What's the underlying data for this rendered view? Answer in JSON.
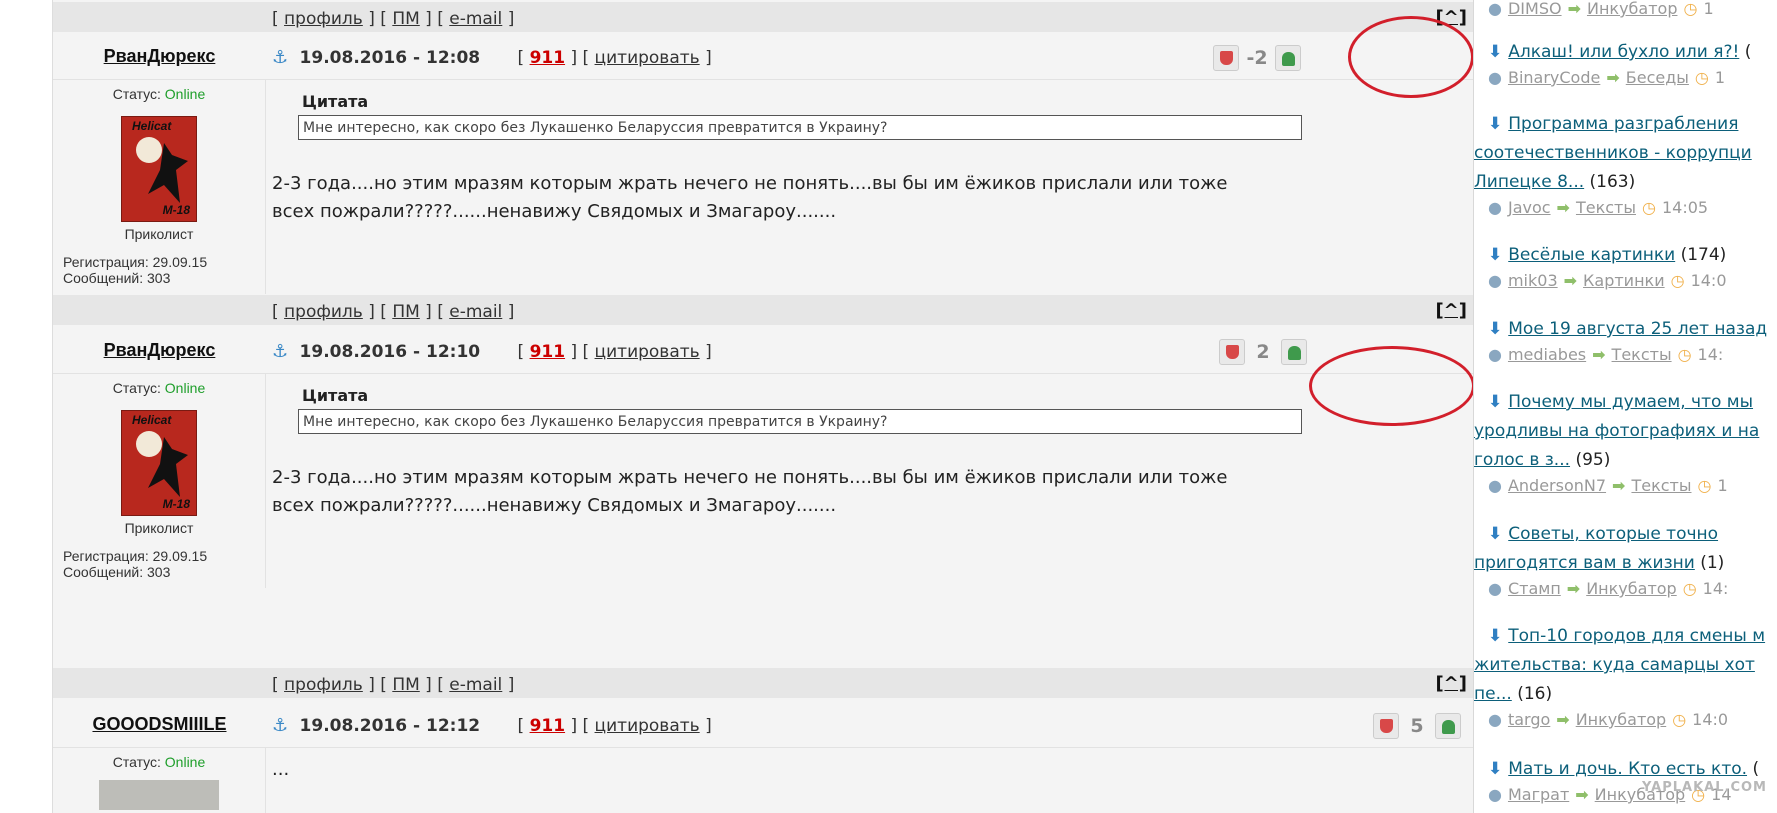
{
  "bar_links": {
    "open": "[",
    "profile": "профиль",
    "sep1": "] [",
    "pm": "ПМ",
    "sep2": "] [",
    "email": "e-mail",
    "close": "]",
    "top": "[^]"
  },
  "posts": [
    {
      "author": "РванДюрекс",
      "anchor": "⚓",
      "date": "19.08.2016 - 12:08",
      "num": "911",
      "cite": "цитировать",
      "rating": "-2",
      "status_label": "Статус:",
      "status": "Online",
      "avatar_text_top": "Helicat",
      "avatar_text_bottom": "M-18",
      "rank": "Приколист",
      "reg": "Регистрация: 29.09.15",
      "msgs": "Сообщений: 303",
      "quote_title": "Цитата",
      "quote": "Мне интересно, как скоро без Лукашенко Беларуссия превратится в Украину?",
      "text": "2-3 года....но этим мразям которым жрать нечего не понять....вы бы им ёжиков прислали или тоже всех пожрали?????......ненавижу Свядомых и Змагароу......."
    },
    {
      "author": "РванДюрекс",
      "anchor": "⚓",
      "date": "19.08.2016 - 12:10",
      "num": "911",
      "cite": "цитировать",
      "rating": "2",
      "status_label": "Статус:",
      "status": "Online",
      "avatar_text_top": "Helicat",
      "avatar_text_bottom": "M-18",
      "rank": "Приколист",
      "reg": "Регистрация: 29.09.15",
      "msgs": "Сообщений: 303",
      "quote_title": "Цитата",
      "quote": "Мне интересно, как скоро без Лукашенко Беларуссия превратится в Украину?",
      "text": "2-3 года....но этим мразям которым жрать нечего не понять....вы бы им ёжиков прислали или тоже всех пожрали?????......ненавижу Свядомых и Змагароу......."
    },
    {
      "author": "GOOODSMIIILE",
      "anchor": "⚓",
      "date": "19.08.2016 - 12:12",
      "num": "911",
      "cite": "цитировать",
      "rating": "5",
      "status_label": "Статус:",
      "status": "Online",
      "text": "..."
    }
  ],
  "sidebar": {
    "items": [
      {
        "title": "",
        "count": "",
        "user": "DIMSO",
        "section": "Инкубатор",
        "time": "1"
      },
      {
        "title": "Алкаш! или бухло или я?!",
        "count": "(",
        "user": "BinaryCode",
        "section": "Беседы",
        "time": "1"
      },
      {
        "title_lines": [
          "Программа разграбления",
          "соотечественников - коррупци",
          "Липецке 8..."
        ],
        "count": "(163)",
        "user": "Javoc",
        "section": "Тексты",
        "time": "14:05"
      },
      {
        "title": "Весёлые картинки",
        "count": "(174)",
        "user": "mik03",
        "section": "Картинки",
        "time": "14:0"
      },
      {
        "title": "Мое 19 августа 25 лет назад",
        "count": "",
        "user": "mediabes",
        "section": "Тексты",
        "time": "14:"
      },
      {
        "title_lines": [
          "Почему мы думаем, что мы",
          "уродливы на фотографиях и на",
          "голос в з..."
        ],
        "count": "(95)",
        "user": "AndersonN7",
        "section": "Тексты",
        "time": "1"
      },
      {
        "title_lines": [
          "Советы, которые точно",
          "пригодятся вам в жизни"
        ],
        "count": "(1)",
        "user": "Стамп",
        "section": "Инкубатор",
        "time": "14:"
      },
      {
        "title_lines": [
          "Топ-10 городов для смены м",
          "жительства: куда самарцы хот",
          "пе..."
        ],
        "count": "(16)",
        "user": "targo",
        "section": "Инкубатор",
        "time": "14:0"
      },
      {
        "title": "Мать и дочь. Кто есть кто.",
        "count": "(",
        "user": "Маграт",
        "section": "Инкубатор",
        "time": "14"
      }
    ],
    "watermark": "YAPLAKAL.COM"
  },
  "icons": {
    "anchor": "anchor-icon",
    "user": "user-icon",
    "arrow": "arrow-right-icon",
    "clock": "clock-icon",
    "thumb_down": "thumb-down-icon",
    "thumb_up": "thumb-up-icon"
  },
  "colors": {
    "accent_red": "#d21f2b",
    "online": "#1e9e2a",
    "link": "#0c5f7a",
    "rating_num": "#c00"
  }
}
